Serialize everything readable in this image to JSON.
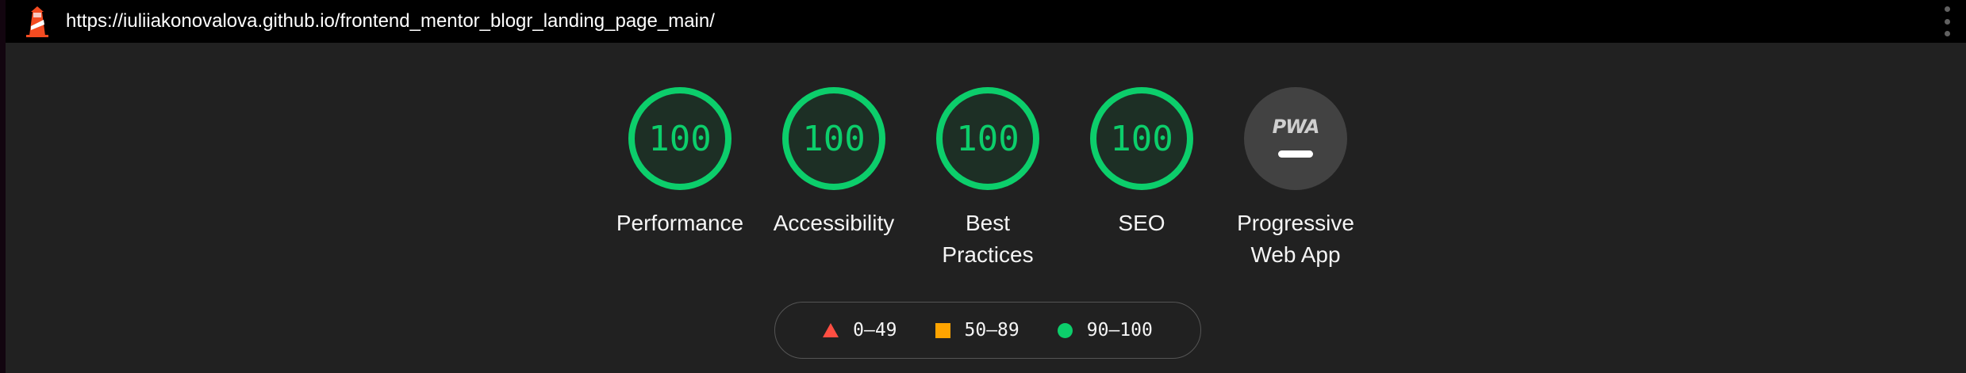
{
  "browser": {
    "url": "https://iuliiakonovalova.github.io/frontend_mentor_blogr_landing_page_main/",
    "logo_icon": "lighthouse-icon",
    "menu_icon": "kebab-menu-icon"
  },
  "gauges": [
    {
      "score": "100",
      "label": "Performance"
    },
    {
      "score": "100",
      "label": "Accessibility"
    },
    {
      "score": "100",
      "label": "Best Practices"
    },
    {
      "score": "100",
      "label": "SEO"
    }
  ],
  "pwa": {
    "badge_text": "PWA",
    "label": "Progressive Web App"
  },
  "legend": [
    {
      "range": "0–49",
      "color": "#ff4e42",
      "shape": "triangle"
    },
    {
      "range": "50–89",
      "color": "#ffa400",
      "shape": "square"
    },
    {
      "range": "90–100",
      "color": "#0cce6b",
      "shape": "circle"
    }
  ],
  "colors": {
    "pass": "#0cce6b",
    "average": "#ffa400",
    "fail": "#ff4e42",
    "background": "#212121"
  }
}
